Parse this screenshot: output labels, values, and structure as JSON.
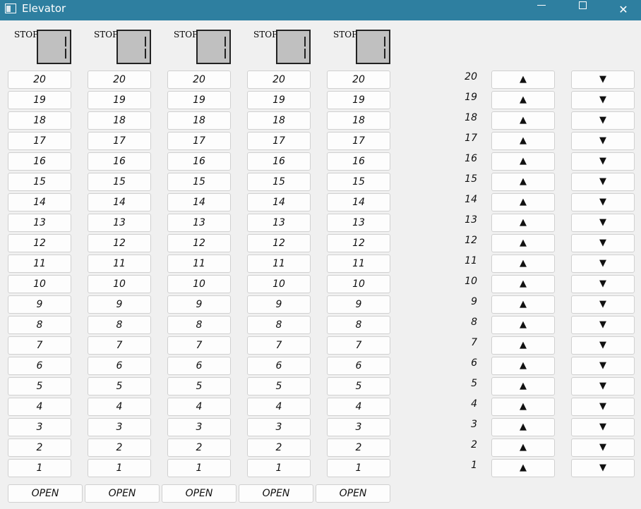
{
  "window": {
    "title": "Elevator",
    "app_icon": "window-icon",
    "min_icon": "minimize-icon",
    "max_icon": "maximize-icon",
    "close_icon": "close-icon",
    "close_glyph": "✕"
  },
  "elevators": [
    {
      "stop_label": "STOP",
      "display_value": "1",
      "open_label": "OPEN"
    },
    {
      "stop_label": "STOP",
      "display_value": "1",
      "open_label": "OPEN"
    },
    {
      "stop_label": "STOP",
      "display_value": "1",
      "open_label": "OPEN"
    },
    {
      "stop_label": "STOP",
      "display_value": "1",
      "open_label": "OPEN"
    },
    {
      "stop_label": "STOP",
      "display_value": "1",
      "open_label": "OPEN"
    }
  ],
  "floors": [
    "20",
    "19",
    "18",
    "17",
    "16",
    "15",
    "14",
    "13",
    "12",
    "11",
    "10",
    "9",
    "8",
    "7",
    "6",
    "5",
    "4",
    "3",
    "2",
    "1"
  ],
  "hall": {
    "up_glyph": "▲",
    "down_glyph": "▼",
    "up_icon": "up-arrow-icon",
    "down_icon": "down-arrow-icon"
  },
  "colors": {
    "titlebar": "#2e7fa0",
    "background": "#f0f0f0",
    "display_bg": "#c0c0c0"
  }
}
